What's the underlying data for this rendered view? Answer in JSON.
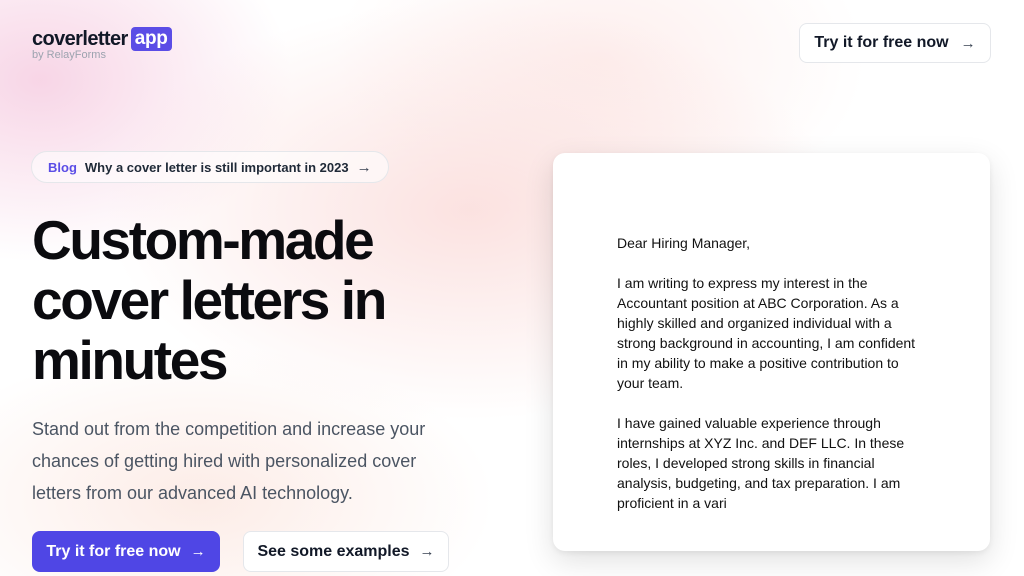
{
  "logo": {
    "name": "coverletter",
    "badge": "app",
    "byline": "by RelayForms"
  },
  "nav": {
    "cta_label": "Try it for free now",
    "cta_icon": "arrow-right-icon"
  },
  "blog_banner": {
    "tag": "Blog",
    "title": "Why a cover letter is still important in 2023",
    "icon": "arrow-right-icon"
  },
  "hero": {
    "headline": "Custom-made cover letters in minutes",
    "subtext": "Stand out from the competition and increase your chances of getting hired with personalized cover letters from our advanced AI technology.",
    "primary_cta": "Try it for free now",
    "secondary_cta": "See some examples"
  },
  "letter": {
    "greeting": "Dear Hiring Manager,",
    "paragraph_1": "I am writing to express my interest in the Accountant position at ABC Corporation. As a highly skilled and organized individual with a strong background in accounting, I am confident in my ability to make a positive contribution to your team.",
    "paragraph_2": "I have gained valuable experience through internships at XYZ Inc. and DEF LLC. In these roles, I developed strong skills in financial analysis, budgeting, and tax preparation. I am proficient in a vari"
  },
  "colors": {
    "accent": "#4f46e5",
    "badge": "#5b4de6",
    "text": "#111827",
    "muted": "#4b5563"
  }
}
